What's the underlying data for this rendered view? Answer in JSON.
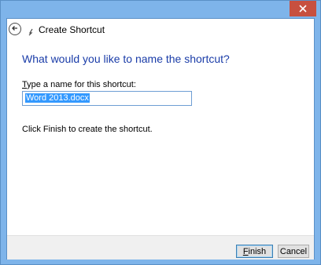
{
  "window": {
    "title": "Create Shortcut",
    "close_glyph": "close-icon"
  },
  "wizard": {
    "heading": "What would you like to name the shortcut?",
    "field_label_accel": "T",
    "field_label_rest": "ype a name for this shortcut:",
    "field_value": "Word 2013.docx",
    "hint": "Click Finish to create the shortcut."
  },
  "buttons": {
    "finish_accel": "F",
    "finish_rest": "inish",
    "cancel": "Cancel"
  },
  "colors": {
    "frame": "#7eb4ea",
    "close": "#c7503f",
    "heading": "#1a3ca8",
    "selection": "#3399ff"
  }
}
